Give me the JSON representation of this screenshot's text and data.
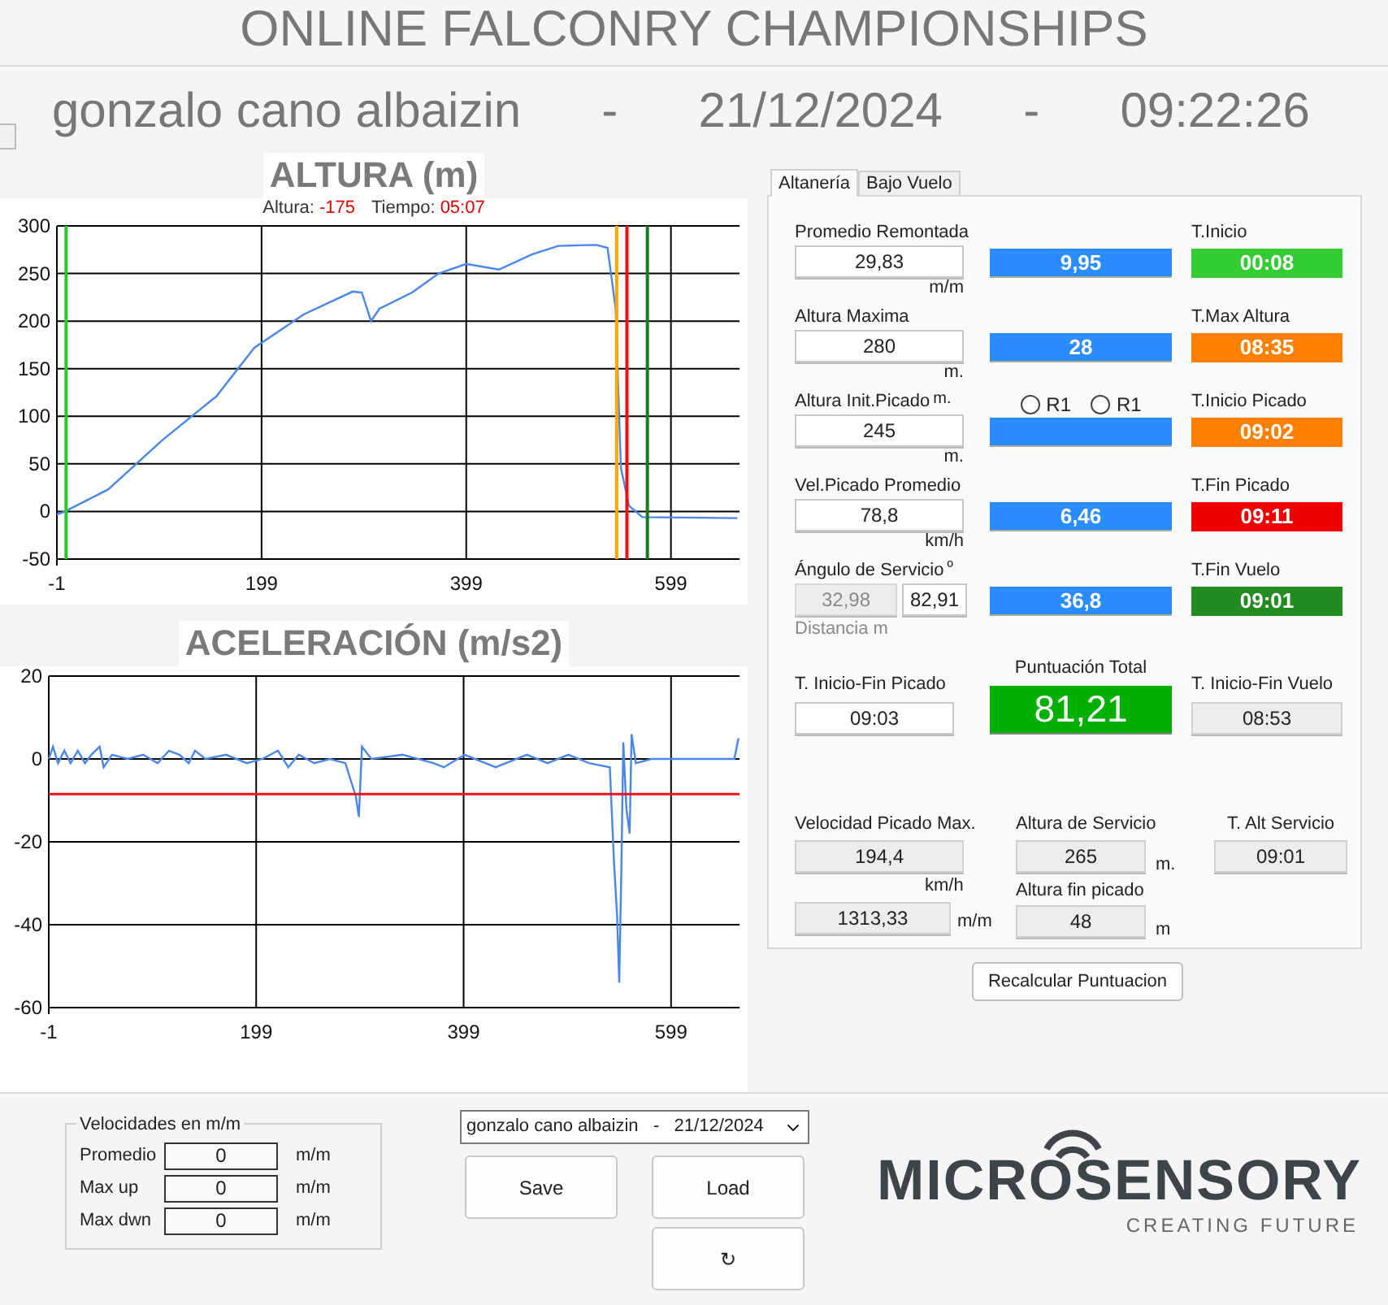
{
  "header": {
    "title": "ONLINE FALCONRY CHAMPIONSHIPS",
    "subtitle_parts": [
      "gonzalo cano albaizin",
      "-",
      "21/12/2024",
      "-",
      "09:22:26"
    ]
  },
  "altitude_chart": {
    "title": "ALTURA (m)",
    "readout": [
      {
        "label": "Altura:",
        "value": "-175"
      },
      {
        "label": "Tiempo:",
        "value": "05:07"
      }
    ],
    "chart_data": {
      "type": "line",
      "xlim": [
        -1,
        666
      ],
      "ylim": [
        -50,
        300
      ],
      "xticks": [
        -1,
        199,
        399,
        599
      ],
      "yticks": [
        -50,
        0,
        50,
        100,
        150,
        200,
        250,
        300
      ],
      "x": [
        -1,
        7,
        49,
        102,
        155,
        192,
        240,
        288,
        297,
        306,
        314,
        346,
        372,
        399,
        431,
        463,
        489,
        526,
        537,
        545,
        550,
        558,
        571,
        664
      ],
      "grid": true,
      "series": [
        {
          "color": "#4a86e8",
          "values": [
            -3,
            0,
            23,
            75,
            121,
            172,
            207,
            231,
            230,
            200,
            213,
            230,
            250,
            260,
            254,
            270,
            279,
            280,
            277,
            213,
            46,
            6,
            -6,
            -7
          ]
        }
      ],
      "ref_lines": [
        {
          "axis": "x",
          "value": 8,
          "color": "#22cc22"
        },
        {
          "axis": "x",
          "value": 546,
          "color": "#ffa500"
        },
        {
          "axis": "x",
          "value": 556,
          "color": "#ee1111"
        },
        {
          "axis": "x",
          "value": 576,
          "color": "#1a7a1a"
        }
      ]
    }
  },
  "acceleration_chart": {
    "title": "ACELERACIÓN (m/s2)",
    "chart_data": {
      "type": "line",
      "xlim": [
        -1,
        665
      ],
      "ylim": [
        -60,
        20
      ],
      "xticks": [
        -1,
        199,
        399,
        599
      ],
      "yticks": [
        -60,
        -40,
        -20,
        0,
        20
      ],
      "x": [
        -1,
        3,
        8,
        14,
        20,
        27,
        34,
        40,
        48,
        52,
        60,
        75,
        90,
        104,
        115,
        125,
        134,
        140,
        150,
        170,
        190,
        205,
        220,
        230,
        240,
        255,
        270,
        285,
        295,
        298,
        301,
        310,
        340,
        370,
        380,
        400,
        430,
        460,
        480,
        500,
        520,
        540,
        544,
        547,
        549,
        551,
        553,
        556,
        559,
        561,
        565,
        580,
        600,
        660,
        664
      ],
      "grid": true,
      "series": [
        {
          "color": "#4a86e8",
          "values": [
            0,
            3,
            -1,
            2,
            -1,
            2,
            -1,
            1,
            3,
            -2,
            1,
            0,
            1,
            -1,
            2,
            1,
            -1,
            2,
            0,
            1,
            -1,
            0,
            2,
            -2,
            1,
            -1,
            0,
            -1,
            -9,
            -14,
            3,
            0,
            1,
            -1,
            -2,
            1,
            -2,
            1,
            -1,
            1,
            -1,
            -2,
            -25,
            -38,
            -54,
            -27,
            4,
            -12,
            -18,
            6,
            -1,
            0,
            0,
            0,
            5
          ]
        }
      ],
      "ref_lines": [
        {
          "axis": "y",
          "value": -8.5,
          "color": "#ee1111"
        }
      ]
    }
  },
  "tabs": [
    {
      "label": "Altanería",
      "selected": true
    },
    {
      "label": "Bajo Vuelo",
      "selected": false
    }
  ],
  "rows": [
    {
      "label": "Promedio Remontada",
      "fields": [
        {
          "value": "29,83",
          "disabled": false
        }
      ],
      "unit": "m/m",
      "score": "9,95",
      "timer": {
        "label": "T.Inicio",
        "value": "00:08",
        "color": "#33cc33"
      }
    },
    {
      "label": "Altura Maxima",
      "fields": [
        {
          "value": "280",
          "disabled": false
        }
      ],
      "unit": "m.",
      "score": "28",
      "timer": {
        "label": "T.Max Altura",
        "value": "08:35",
        "color": "#ff8000"
      }
    },
    {
      "label": "Altura Init.Picado",
      "label_unit": "m.",
      "fields": [
        {
          "value": "245",
          "disabled": false
        }
      ],
      "unit": "m.",
      "radios": [
        {
          "label": "R1",
          "selected": false
        },
        {
          "label": "R1",
          "selected": false
        }
      ],
      "timer": {
        "label": "T.Inicio Picado",
        "value": "09:02",
        "color": "#ff8000"
      }
    },
    {
      "label": "Vel.Picado Promedio",
      "fields": [
        {
          "value": "78,8",
          "disabled": false
        }
      ],
      "unit": "km/h",
      "score": "6,46",
      "timer": {
        "label": "T.Fin Picado",
        "value": "09:11",
        "color": "#ee0000"
      }
    },
    {
      "label": "Ángulo de Servicio",
      "label_unit": "º",
      "fields": [
        {
          "value": "32,98",
          "disabled": true
        },
        {
          "value": "82,91",
          "disabled": false
        }
      ],
      "note": "Distancia m",
      "score": "36,8",
      "timer": {
        "label": "T.Fin Vuelo",
        "value": "09:01",
        "color": "#228b22"
      }
    }
  ],
  "summary": [
    {
      "kind": "field",
      "label": "T. Inicio-Fin Picado",
      "value": "09:03"
    },
    {
      "kind": "total",
      "label": "Puntuación Total",
      "value": "81,21"
    },
    {
      "kind": "readonly",
      "label": "T. Inicio-Fin Vuelo",
      "value": "08:53"
    }
  ],
  "service": {
    "max_speed": {
      "label": "Velocidad Picado Max.",
      "value": "194,4",
      "unit": "km/h"
    },
    "max_rate": {
      "value": "1313,33",
      "unit": "m/m"
    },
    "service_altitude": {
      "label": "Altura de Servicio",
      "value": "265",
      "unit": "m."
    },
    "end_altitude": {
      "label": "Altura fin picado",
      "value": "48",
      "unit": "m"
    },
    "service_time": {
      "label": "T. Alt Servicio",
      "value": "09:01"
    }
  },
  "recalc_button": "Recalcular Puntuacion",
  "speeds": {
    "title": "Velocidades en m/m",
    "rows": [
      {
        "label": "Promedio",
        "value": "0",
        "unit": "m/m"
      },
      {
        "label": "Max up",
        "value": "0",
        "unit": "m/m"
      },
      {
        "label": "Max dwn",
        "value": "0",
        "unit": "m/m"
      }
    ]
  },
  "session_select": "gonzalo cano albaizin   -   21/12/2024",
  "buttons": [
    "Save",
    "Load",
    "↻"
  ],
  "logo": {
    "name": "MICROSENSORY",
    "tagline": "CREATING FUTURE"
  }
}
